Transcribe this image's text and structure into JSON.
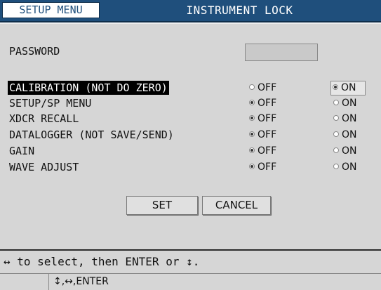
{
  "header": {
    "menu_label": "SETUP MENU",
    "title": "INSTRUMENT LOCK"
  },
  "password": {
    "label": "PASSWORD",
    "value": ""
  },
  "settings": [
    {
      "label": "CALIBRATION (NOT DO ZERO)",
      "off_label": "OFF",
      "on_label": "ON",
      "selected": "ON",
      "highlighted": true
    },
    {
      "label": "SETUP/SP MENU",
      "off_label": "OFF",
      "on_label": "ON",
      "selected": "OFF",
      "highlighted": false
    },
    {
      "label": "XDCR RECALL",
      "off_label": "OFF",
      "on_label": "ON",
      "selected": "OFF",
      "highlighted": false
    },
    {
      "label": "DATALOGGER (NOT SAVE/SEND)",
      "off_label": "OFF",
      "on_label": "ON",
      "selected": "OFF",
      "highlighted": false
    },
    {
      "label": "GAIN",
      "off_label": "OFF",
      "on_label": "ON",
      "selected": "OFF",
      "highlighted": false
    },
    {
      "label": "WAVE ADJUST",
      "off_label": "OFF",
      "on_label": "ON",
      "selected": "OFF",
      "highlighted": false
    }
  ],
  "buttons": {
    "set": "SET",
    "cancel": "CANCEL"
  },
  "help_text": "↔ to select, then ENTER or ↕.",
  "status_text": "↕,↔,ENTER",
  "colors": {
    "title_bar": "#1f4f7c",
    "background": "#d6d6d6",
    "highlight": "#000000"
  }
}
